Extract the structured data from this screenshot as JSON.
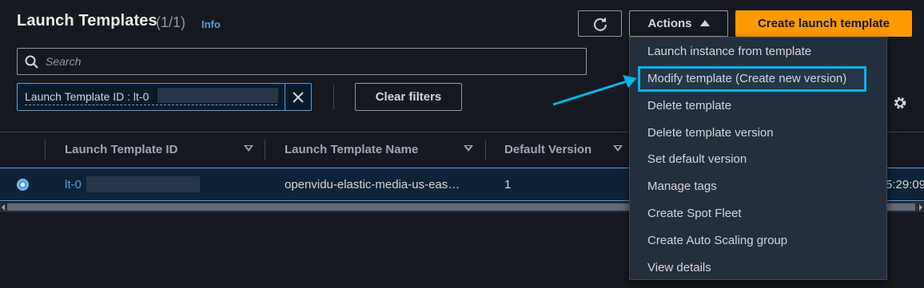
{
  "header": {
    "title": "Launch Templates",
    "count": "(1/1)",
    "info": "Info",
    "actions_label": "Actions",
    "create_label": "Create launch template"
  },
  "search": {
    "placeholder": "Search"
  },
  "filter": {
    "token_label": "Launch Template ID : lt-0",
    "clear_label": "Clear filters"
  },
  "table": {
    "columns": [
      "Launch Template ID",
      "Launch Template Name",
      "Default Version"
    ],
    "rows": [
      {
        "id": "lt-0",
        "name": "openvidu-elastic-media-us-eas…",
        "default_version": "1",
        "time_fragment": "5:29:09"
      }
    ]
  },
  "actions_menu": {
    "items": [
      "Launch instance from template",
      "Modify template (Create new version)",
      "Delete template",
      "Delete template version",
      "Set default version",
      "Manage tags",
      "Create Spot Fleet",
      "Create Auto Scaling group",
      "View details"
    ],
    "highlighted_index": 1
  },
  "colors": {
    "background": "#16191f",
    "accent": "#ff9900",
    "link": "#539fe5",
    "highlight": "#00b6ea",
    "menu_bg": "#232f3e"
  },
  "icons": [
    "refresh-icon",
    "caret-up-icon",
    "search-icon",
    "close-icon",
    "settings-gear-icon",
    "sort-caret-icon",
    "radio-selected-icon",
    "annotation-arrow"
  ]
}
